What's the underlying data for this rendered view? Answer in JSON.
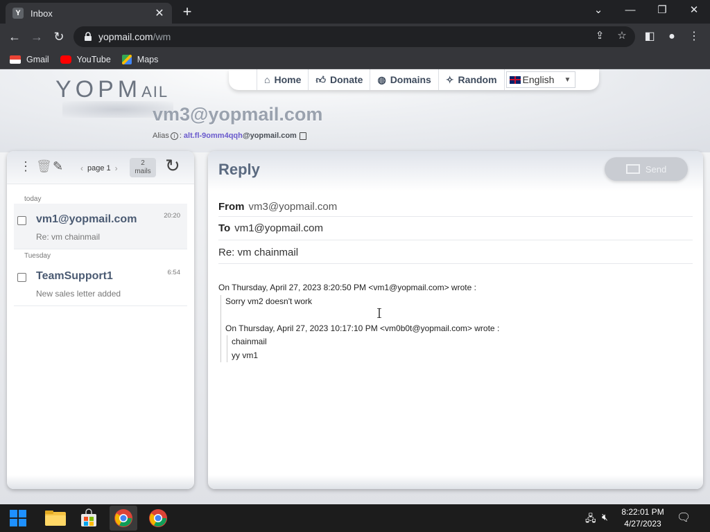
{
  "browser": {
    "tab_title": "Inbox",
    "tab_favicon": "Y",
    "url_host": "yopmail.com",
    "url_path": "/wm",
    "bookmarks": [
      {
        "label": "Gmail",
        "icon": "gmail-icon"
      },
      {
        "label": "YouTube",
        "icon": "youtube-icon"
      },
      {
        "label": "Maps",
        "icon": "maps-icon"
      }
    ]
  },
  "site": {
    "logo_text": "YOPM",
    "logo_small": "AIL",
    "nav": [
      {
        "label": "Home",
        "icon": "home-icon"
      },
      {
        "label": "Donate",
        "icon": "thumbs-up-icon"
      },
      {
        "label": "Domains",
        "icon": "globe-icon"
      },
      {
        "label": "Random",
        "icon": "wand-icon"
      }
    ],
    "language": "English",
    "email_address": "vm3@yopmail.com",
    "alias_label": "Alias",
    "alias_sep": ":",
    "alias_user": "alt.fl-9omm4qqh",
    "alias_domain": "@yopmail.com"
  },
  "inbox": {
    "page_label": "page 1",
    "count_num": "2",
    "count_label": "mails",
    "groups": [
      {
        "day": "today",
        "mails": [
          {
            "from": "vm1@yopmail.com",
            "subject": "Re: vm chainmail",
            "time": "20:20",
            "selected": true
          }
        ]
      },
      {
        "day": "Tuesday",
        "mails": [
          {
            "from": "TeamSupport1",
            "subject": "New sales letter added",
            "time": "6:54",
            "selected": false
          }
        ]
      }
    ]
  },
  "compose": {
    "title": "Reply",
    "send_label": "Send",
    "from_label": "From",
    "from_value": "vm3@yopmail.com",
    "to_label": "To",
    "to_value": "vm1@yopmail.com",
    "subject": "Re: vm chainmail",
    "body": {
      "line1": "On Thursday, April 27, 2023 8:20:50 PM <vm1@yopmail.com> wrote :",
      "line2": "Sorry vm2 doesn't work",
      "line3": "On Thursday, April 27, 2023 10:17:10 PM <vm0b0t@yopmail.com> wrote :",
      "line4": "chainmail",
      "line5": "yy vm1"
    }
  },
  "taskbar": {
    "time": "8:22:01 PM",
    "date": "4/27/2023"
  }
}
